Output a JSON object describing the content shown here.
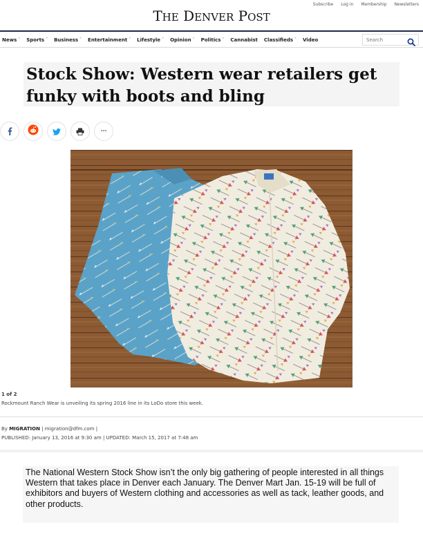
{
  "top_links": [
    "Subscribe",
    "Log in",
    "Membership",
    "Newsletters"
  ],
  "logo": {
    "text": "The Denver Post"
  },
  "nav": {
    "items": [
      {
        "label": "News",
        "dropdown": true
      },
      {
        "label": "Sports",
        "dropdown": true
      },
      {
        "label": "Business",
        "dropdown": true
      },
      {
        "label": "Entertainment",
        "dropdown": true
      },
      {
        "label": "Lifestyle",
        "dropdown": true
      },
      {
        "label": "Opinion",
        "dropdown": true
      },
      {
        "label": "Politics",
        "dropdown": true
      },
      {
        "label": "Cannabist",
        "dropdown": false
      },
      {
        "label": "Classifieds",
        "dropdown": true
      },
      {
        "label": "Video",
        "dropdown": false
      }
    ],
    "search_placeholder": "Search"
  },
  "article": {
    "headline": "Stock Show: Western wear retailers get funky with boots and bling",
    "share_icons": [
      "facebook-icon",
      "reddit-icon",
      "twitter-icon",
      "print-icon",
      "more-icon"
    ],
    "gallery_count": "1 of 2",
    "caption": "Rockmount Ranch Wear is unveiling its spring 2016 line in its LoDo store this week.",
    "byline_prefix": "By",
    "author": "MIGRATION",
    "author_email": "migration@dfm.com",
    "published_label": "PUBLISHED:",
    "published": "January 13, 2016 at 9:30 am",
    "updated_label": "UPDATED:",
    "updated": "March 15, 2017 at 7:48 am",
    "body": "The National Western Stock Show isn’t the only big gathering of people interested in all things Western that takes place in Denver each January. The Denver Mart Jan. 15-19 will be full of exhibitors and buyers of Western clothing and accessories as well as tack, leather goods, and other products."
  },
  "colors": {
    "nav_rule": "#1f2a44",
    "search_icon": "#1a3a8f",
    "facebook": "#3b5998",
    "reddit": "#ff4500",
    "twitter": "#1da1f2",
    "photo_floor": "#8a5a32",
    "shirt_blue": "#5aa2c8",
    "shirt_cream": "#f1ece0"
  }
}
